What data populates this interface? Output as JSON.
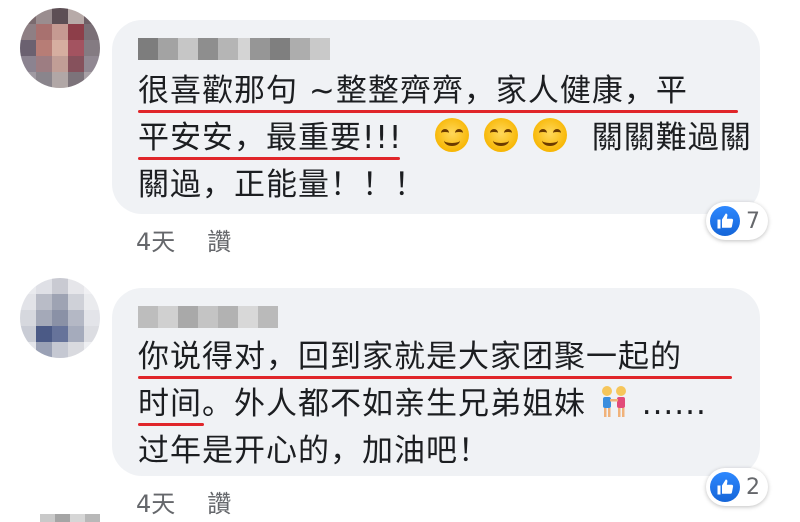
{
  "comments": [
    {
      "lines": [
        "很喜歡那句 ~整整齊齊，家人健康，平",
        "平安安，最重要!!!",
        "關過，正能量！！！"
      ],
      "line2_tail": "關關難過關",
      "time": "4天",
      "like_action": "讚",
      "reaction_count": "7"
    },
    {
      "lines": [
        "你说得对，回到家就是大家团聚一起的",
        "时间。外人都不如亲生兄弟姐妹",
        "过年是开心的，加油吧！"
      ],
      "line2_tail": "......",
      "time": "4天",
      "like_action": "讚",
      "reaction_count": "2"
    }
  ],
  "icons": {
    "smiley": "smiling-face-icon",
    "people": "two-women-icon",
    "like": "thumbs-up-icon"
  },
  "colors": {
    "bubble": "#f0f2f5",
    "underline": "#e0262a",
    "meta_text": "#65676b",
    "like_blue": "#1877f2"
  }
}
